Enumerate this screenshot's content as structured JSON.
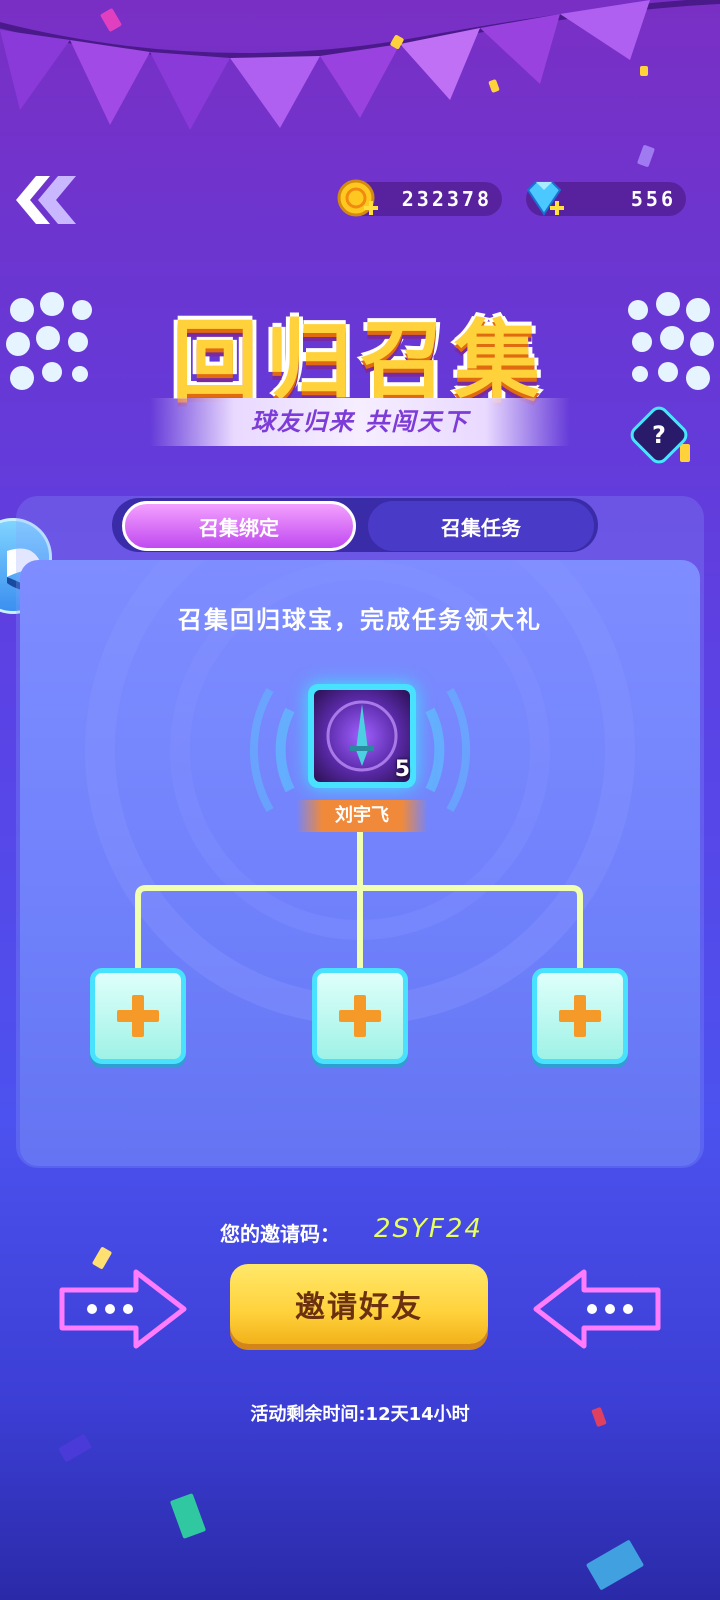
{
  "header": {
    "back_icon": "double-chevron-left-icon",
    "currencies": [
      {
        "icon": "gold-coin-plus-icon",
        "value": "232378"
      },
      {
        "icon": "blue-diamond-plus-icon",
        "value": "556"
      }
    ]
  },
  "title": {
    "main": "回归召集",
    "subtitle": "球友归来 共闯天下",
    "help_label": "?"
  },
  "tabs": [
    {
      "label": "召集绑定",
      "active": true
    },
    {
      "label": "召集任务",
      "active": false
    }
  ],
  "panel": {
    "description": "召集回归球宝，完成任务领大礼",
    "player": {
      "name": "刘宇飞",
      "level": "5",
      "avatar_icon": "purple-sword-orb-icon"
    },
    "slots": [
      {
        "icon": "orange-plus-icon"
      },
      {
        "icon": "orange-plus-icon"
      },
      {
        "icon": "orange-plus-icon"
      }
    ]
  },
  "invite": {
    "label": "您的邀请码：",
    "code": "2SYF24",
    "button_label": "邀请好友"
  },
  "footer": {
    "timer": "活动剩余时间:12天14小时"
  },
  "colors": {
    "accent_cyan": "#48e2ff",
    "accent_yellow": "#ffd23c",
    "accent_pink": "#ff6cff",
    "name_plate": "#f08a3a"
  }
}
